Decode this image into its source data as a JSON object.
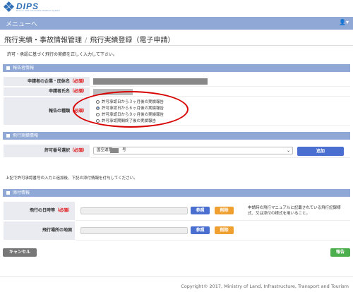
{
  "brand": {
    "name": "DIPS",
    "tagline": "Drone / UAS Information Platform System"
  },
  "menubar": {
    "menu_link": "メニューへ",
    "user_menu": "👤▾"
  },
  "breadcrumb": {
    "parent": "飛行実績・事故情報管理",
    "separator": "/",
    "current": "飛行実績登録（電子申請）"
  },
  "instruction": "許可・承認に基づく飛行の実績を正しく入力して下さい。",
  "sections": {
    "reporter": "報告者情報",
    "flight": "飛行実績情報",
    "attachment": "添付情報"
  },
  "required_mark": "（必須）",
  "reporter": {
    "company_label": "申請者の企業・団体名",
    "name_label": "申請者氏名",
    "report_type_label": "報告の種類",
    "report_options": [
      {
        "label": "許可承認日から３ヶ月後の実績報告",
        "selected": false
      },
      {
        "label": "許可承認日から６ヶ月後の実績報告",
        "selected": true
      },
      {
        "label": "許可承認日から９ヶ月後の実績報告",
        "selected": false
      },
      {
        "label": "許可承認期間終了後の実績報告",
        "selected": false
      }
    ]
  },
  "flight": {
    "permit_label": "許可番号選択",
    "permit_value_prefix": "国空運第",
    "permit_value_suffix": "号",
    "add_button": "追加"
  },
  "after_note": "上記で許可承認番号の入力と追加後、下記の添付情報を付与してください。",
  "attachment": {
    "datetime_label": "飛行の日時等",
    "map_label": "飛行場所の地図",
    "browse_button": "参照",
    "delete_button": "削除",
    "note": "申請時の飛行マニュアルに記載されている飛行記録様式、又は添付の様式を用いること。"
  },
  "actions": {
    "cancel": "キャンセル",
    "report": "報告"
  },
  "footer": "Copyright© 2017, Ministry of Land, Infrastructure, Transport and Tourism",
  "colors": {
    "menu": "#8fa8d6",
    "brand": "#2e6fb6",
    "required": "#d00000",
    "annotation": "#d80000"
  }
}
